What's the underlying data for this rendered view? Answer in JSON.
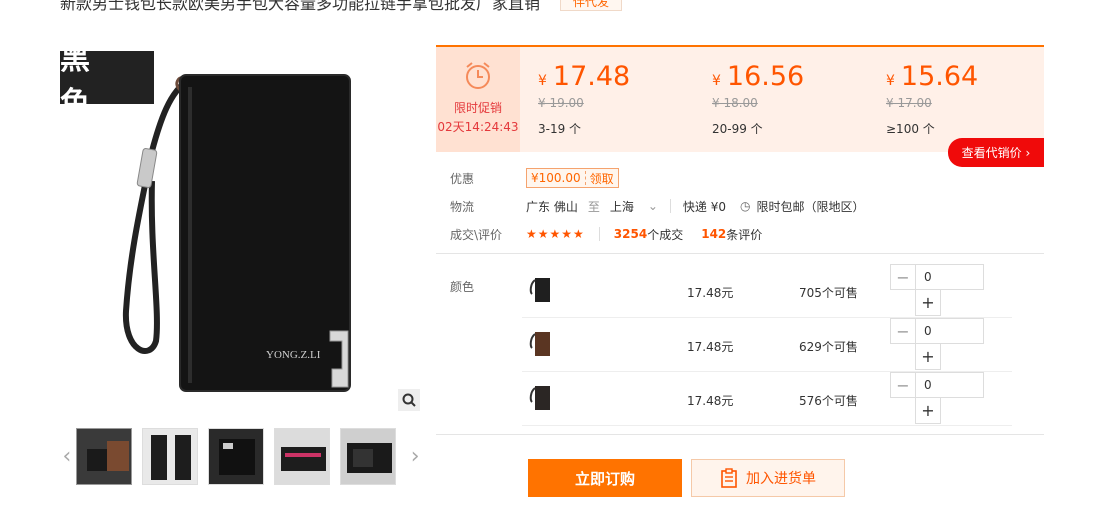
{
  "product": {
    "title": "新款男士钱包长款欧美男手包大容量多功能拉链手拿包批发厂家直销",
    "tag": "伴代发",
    "main_color_label": "黑 色",
    "brand_text": "YONG.Z.LI"
  },
  "promotion": {
    "title": "限时促销",
    "countdown": "02天14:24:43"
  },
  "price_tiers": [
    {
      "currency": "¥",
      "price": "17.48",
      "original": "¥ 19.00",
      "range": "3-19 个"
    },
    {
      "currency": "¥",
      "price": "16.56",
      "original": "¥ 18.00",
      "range": "20-99 个"
    },
    {
      "currency": "¥",
      "price": "15.64",
      "original": "¥ 17.00",
      "range": "≥100 个"
    }
  ],
  "agent_price_button": "查看代销价",
  "info": {
    "discount_label": "优惠",
    "coupon_value": "¥100.00",
    "coupon_action": "领取",
    "logistics_label": "物流",
    "from": "广东 佛山",
    "to_word": "至",
    "dest": "上海",
    "express": "快递 ¥0",
    "free_shipping": "限时包邮（限地区）",
    "deals_label": "成交\\评价",
    "stars": "★★★★★",
    "deal_count": "3254",
    "deal_suffix": "个成交",
    "review_count": "142",
    "review_suffix": "条评价"
  },
  "sku": {
    "label": "颜色",
    "rows": [
      {
        "price": "17.48元",
        "stock": "705个可售",
        "qty": "0",
        "color": "#1f1f1f"
      },
      {
        "price": "17.48元",
        "stock": "629个可售",
        "qty": "0",
        "color": "#5a3522"
      },
      {
        "price": "17.48元",
        "stock": "576个可售",
        "qty": "0",
        "color": "#2b2624"
      }
    ]
  },
  "actions": {
    "buy": "立即订购",
    "add_list": "加入进货单"
  },
  "colors": {
    "accent": "#ff7300",
    "price": "#ff5500",
    "red": "#f00a0a"
  }
}
